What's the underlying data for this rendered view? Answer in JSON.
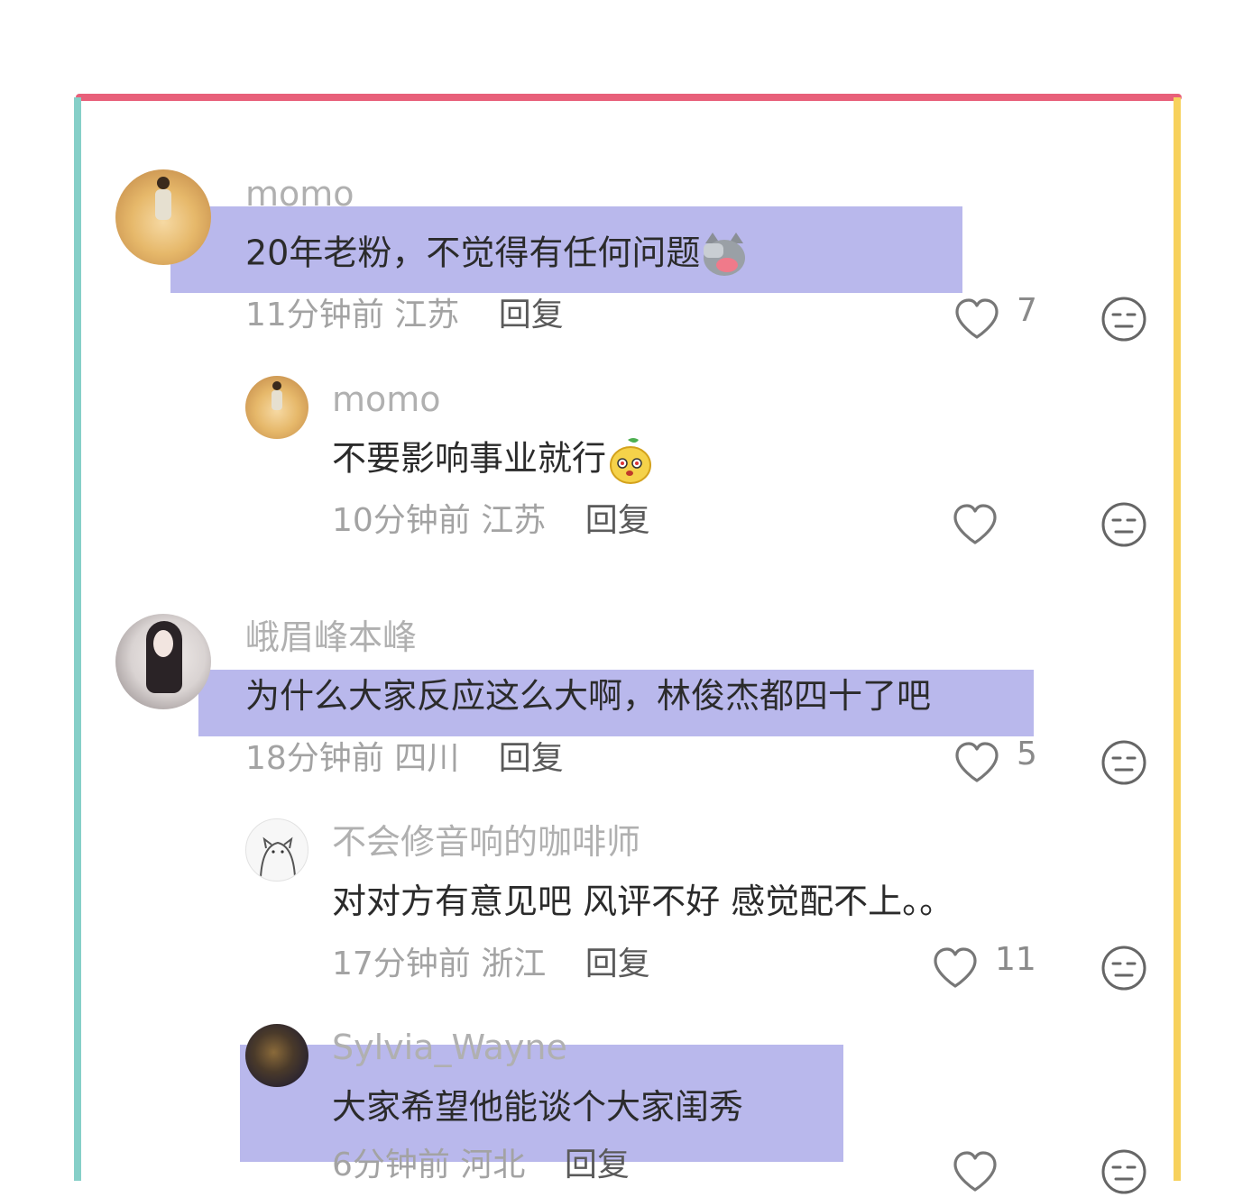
{
  "comments": [
    {
      "username": "momo",
      "text": "20年老粉，不觉得有任何问题",
      "time": "11分钟前",
      "location": "江苏",
      "reply_label": "回复",
      "likes": "7",
      "emoji": "cat-facepalm-emoji",
      "replies": [
        {
          "username": "momo",
          "text": "不要影响事业就行",
          "time": "10分钟前",
          "location": "江苏",
          "reply_label": "回复",
          "likes": "",
          "emoji": "pear-face-emoji"
        }
      ]
    },
    {
      "username": "峨眉峰本峰",
      "text": "为什么大家反应这么大啊，林俊杰都四十了吧",
      "time": "18分钟前",
      "location": "四川",
      "reply_label": "回复",
      "likes": "5",
      "replies": [
        {
          "username": "不会修音响的咖啡师",
          "text": "对对方有意见吧 风评不好 感觉配不上。。",
          "time": "17分钟前",
          "location": "浙江",
          "reply_label": "回复",
          "likes": "11"
        },
        {
          "username": "Sylvia_Wayne",
          "text": "大家希望他能谈个大家闺秀",
          "time": "6分钟前",
          "location": "河北",
          "reply_label": "回复",
          "likes": ""
        }
      ]
    }
  ],
  "colors": {
    "frame_top": "#e8607a",
    "frame_left": "#86cfc8",
    "frame_right": "#f7d15c",
    "highlight": "#a9a8e8"
  },
  "icons": {
    "like": "heart-outline-icon",
    "dislike": "neutral-face-icon"
  }
}
